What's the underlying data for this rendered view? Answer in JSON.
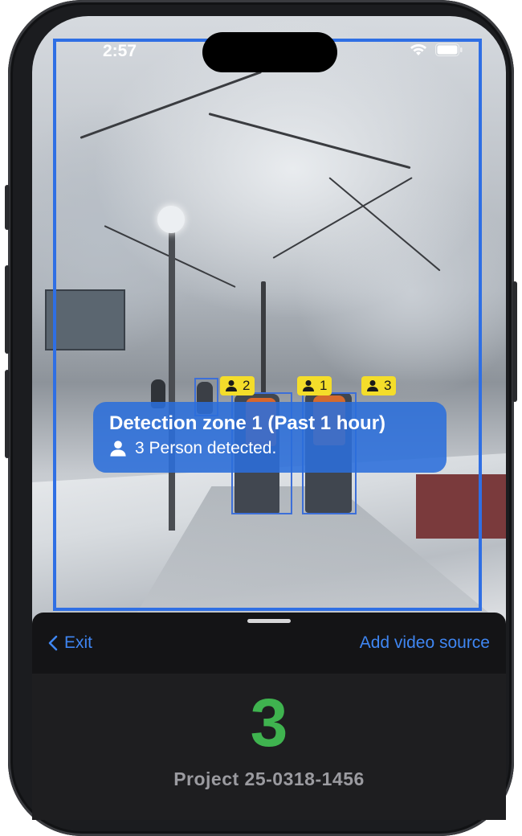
{
  "status_bar": {
    "time": "2:57",
    "icons": [
      "wifi-icon",
      "battery-icon"
    ]
  },
  "detection": {
    "zone_color": "#2f6fe4",
    "person_tags": [
      {
        "label": "2"
      },
      {
        "label": "1"
      },
      {
        "label": "3"
      }
    ],
    "callout": {
      "title": "Detection zone 1 (Past 1 hour)",
      "summary": "3 Person detected."
    }
  },
  "sheet": {
    "exit_label": "Exit",
    "add_source_label": "Add video source",
    "count": "3",
    "project": "Project 25-0318-1456"
  },
  "colors": {
    "accent": "#3f86f2",
    "count_green": "#3fb34f",
    "tag_yellow": "#f4dd2a",
    "callout_blue": "#2b6edb"
  }
}
